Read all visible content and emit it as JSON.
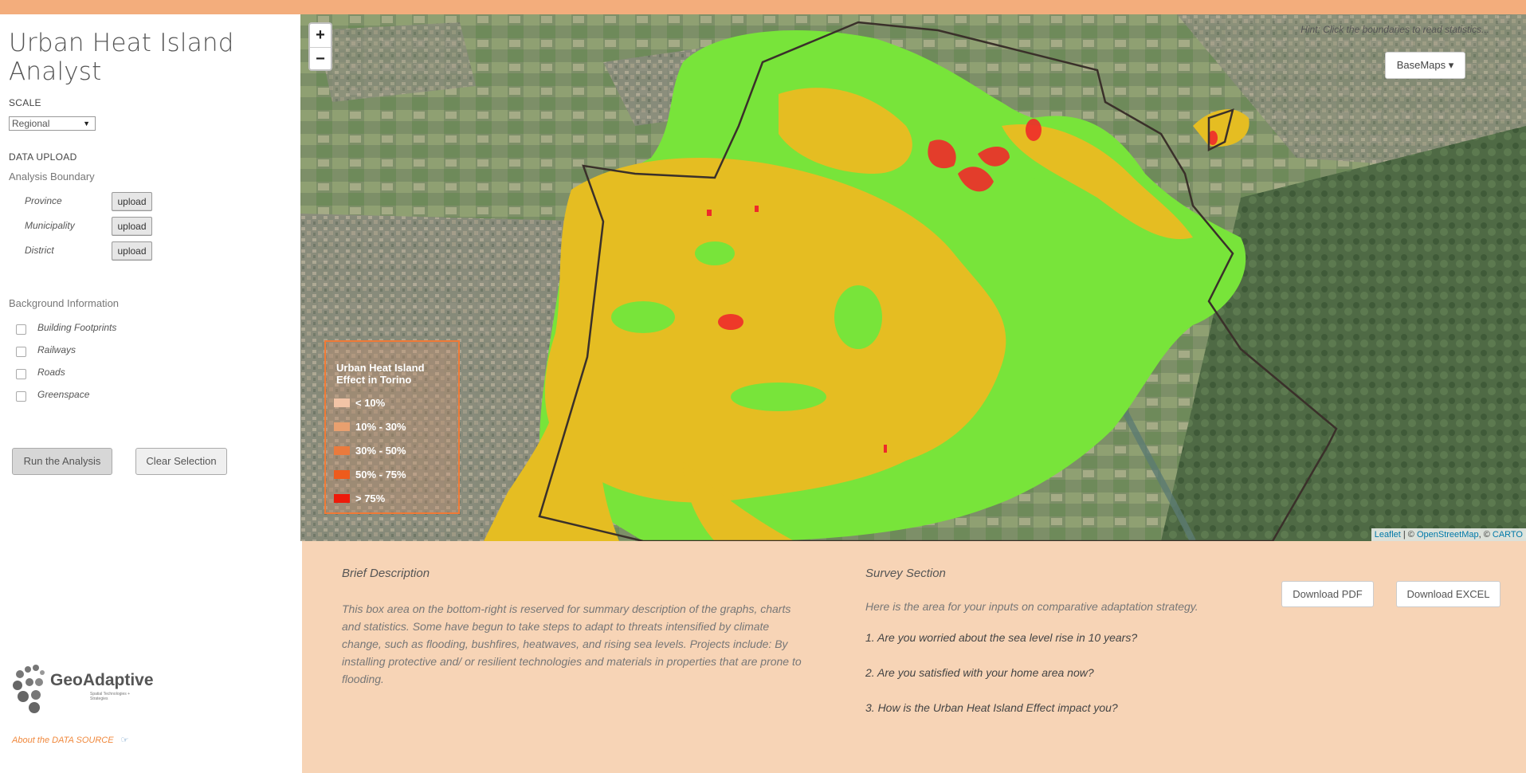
{
  "app": {
    "title": "Urban Heat Island Analyst"
  },
  "sidebar": {
    "scale_label": "SCALE",
    "scale_value": "Regional",
    "data_upload_label": "DATA UPLOAD",
    "analysis_boundary_label": "Analysis Boundary",
    "boundaries": [
      {
        "label": "Province",
        "button": "upload"
      },
      {
        "label": "Municipality",
        "button": "upload"
      },
      {
        "label": "District",
        "button": "upload"
      }
    ],
    "background_label": "Background Information",
    "layers": [
      {
        "label": "Building Footprints",
        "checked": false
      },
      {
        "label": "Railways",
        "checked": false
      },
      {
        "label": "Roads",
        "checked": false
      },
      {
        "label": "Greenspace",
        "checked": false
      }
    ],
    "run_button": "Run the Analysis",
    "clear_button": "Clear Selection",
    "logo_text": "GeoAdaptive",
    "logo_sub": "Spatial Technologies + Strategies",
    "about_link": "About the DATA SOURCE"
  },
  "map": {
    "zoom_in": "+",
    "zoom_out": "−",
    "hint": "Hint: Click the boundaries to read statistics...",
    "basemaps_button": "BaseMaps ▾",
    "legend": {
      "title": "Urban Heat Island Effect in Torino",
      "items": [
        {
          "label": "< 10%",
          "color": "#f2c4a6"
        },
        {
          "label": "10% - 30%",
          "color": "#e8a06f"
        },
        {
          "label": "30% - 50%",
          "color": "#ea7a3d"
        },
        {
          "label": "50% - 75%",
          "color": "#ee5b1c"
        },
        {
          "label": "> 75%",
          "color": "#ee1a0a"
        }
      ]
    },
    "attribution": {
      "leaflet": "Leaflet",
      "sep": " | © ",
      "osm": "OpenStreetMap",
      "sep2": ", © ",
      "carto": "CARTO"
    }
  },
  "bottom": {
    "description_title": "Brief Description",
    "description_text": "This box area on the bottom-right is reserved for summary description of the graphs, charts and statistics. Some have begun to take steps to adapt to threats intensified by climate change, such as flooding, bushfires, heatwaves, and rising sea levels. Projects include: By installing protective and/ or resilient technologies and materials in properties that are prone to flooding.",
    "survey_title": "Survey Section",
    "survey_intro": "Here is the area for your inputs on comparative adaptation strategy.",
    "questions": [
      "1. Are you worried about the sea level rise in 10 years?",
      "2. Are you satisfied with your home area now?",
      "3. How is the Urban Heat Island Effect impact you?"
    ],
    "download_pdf": "Download PDF",
    "download_excel": "Download EXCEL"
  }
}
